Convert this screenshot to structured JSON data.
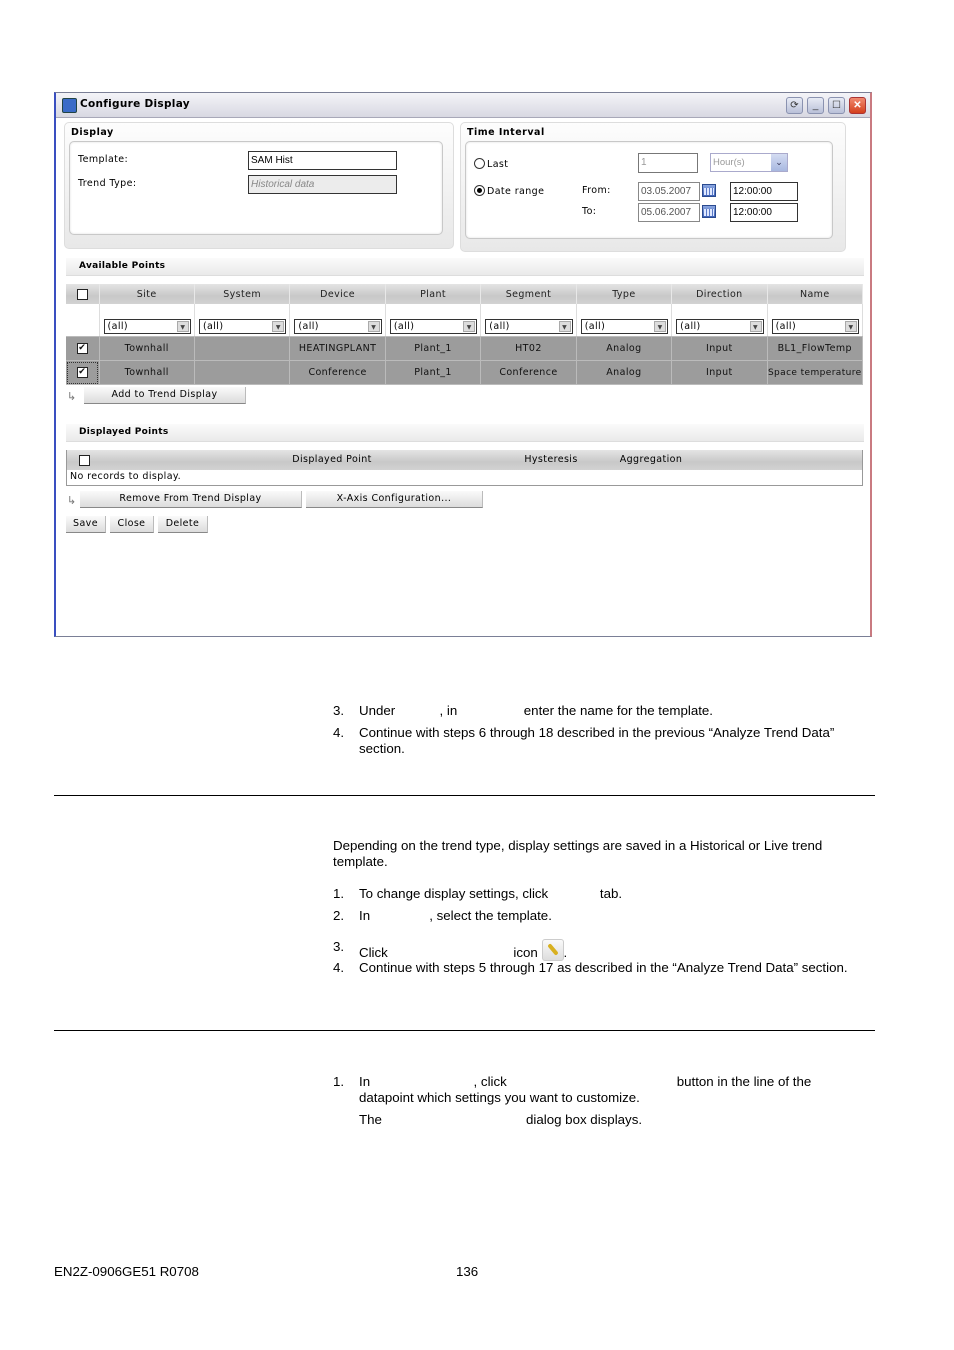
{
  "window": {
    "title": "Configure Display",
    "buttons": {
      "refresh": "⟳",
      "minimize": "_",
      "maximize": "☐",
      "close": "✕"
    }
  },
  "display_panel": {
    "title": "Display",
    "template_label": "Template:",
    "template_value": "SAM Hist",
    "trend_type_label": "Trend Type:",
    "trend_type_value": "Historical data"
  },
  "time_interval": {
    "title": "Time Interval",
    "last_label": "Last",
    "last_value": "1",
    "last_unit": "Hour(s)",
    "date_range_label": "Date range",
    "selected": "Date range",
    "from_label": "From:",
    "from_date": "03.05.2007",
    "from_time": "12:00:00",
    "to_label": "To:",
    "to_date": "05.06.2007",
    "to_time": "12:00:00"
  },
  "available_points": {
    "title": "Available Points",
    "columns": [
      "Site",
      "System",
      "Device",
      "Plant",
      "Segment",
      "Type",
      "Direction",
      "Name"
    ],
    "filter_value": "(all)",
    "rows": [
      {
        "checked": true,
        "cells": [
          "Townhall",
          "",
          "HEATINGPLANT",
          "Plant_1",
          "HT02",
          "Analog",
          "Input",
          "BL1_FlowTemp"
        ]
      },
      {
        "checked": true,
        "cells": [
          "Townhall",
          "",
          "Conference",
          "Plant_1",
          "Conference",
          "Analog",
          "Input",
          "Space temperature"
        ]
      }
    ],
    "add_button": "Add to Trend Display"
  },
  "displayed_points": {
    "title": "Displayed Points",
    "columns": [
      "Displayed Point",
      "Hysteresis",
      "Aggregation"
    ],
    "empty_text": "No records to display.",
    "remove_button": "Remove From Trend Display",
    "xaxis_button": "X-Axis Configuration..."
  },
  "actions": {
    "save": "Save",
    "close": "Close",
    "delete": "Delete"
  },
  "doc": {
    "section1": [
      {
        "num": "3.",
        "text": "Under            , in                  enter the name for the template."
      },
      {
        "num": "4.",
        "text": "Continue with steps 6 through 18 described in the previous “Analyze Trend Data” section."
      }
    ],
    "section2_intro": "Depending on the trend type, display settings are saved in a Historical or Live trend template.",
    "section2": [
      {
        "num": "1.",
        "text": "To change display settings, click              tab."
      },
      {
        "num": "2.",
        "text": "In                , select the template."
      },
      {
        "num": "3.",
        "text": "Click                                  icon"
      },
      {
        "num": "4.",
        "text": "Continue with steps 5 through 17 as described in the “Analyze Trend Data” section."
      }
    ],
    "section3": [
      {
        "num": "1.",
        "text": "In                            , click                                              button in the line of the datapoint which settings you want to customize."
      }
    ],
    "section3_note": "The                                       dialog box displays.",
    "icon_name": "wrench-icon"
  },
  "footer": {
    "doc_id": "EN2Z-0906GE51 R0708",
    "page": "136"
  }
}
